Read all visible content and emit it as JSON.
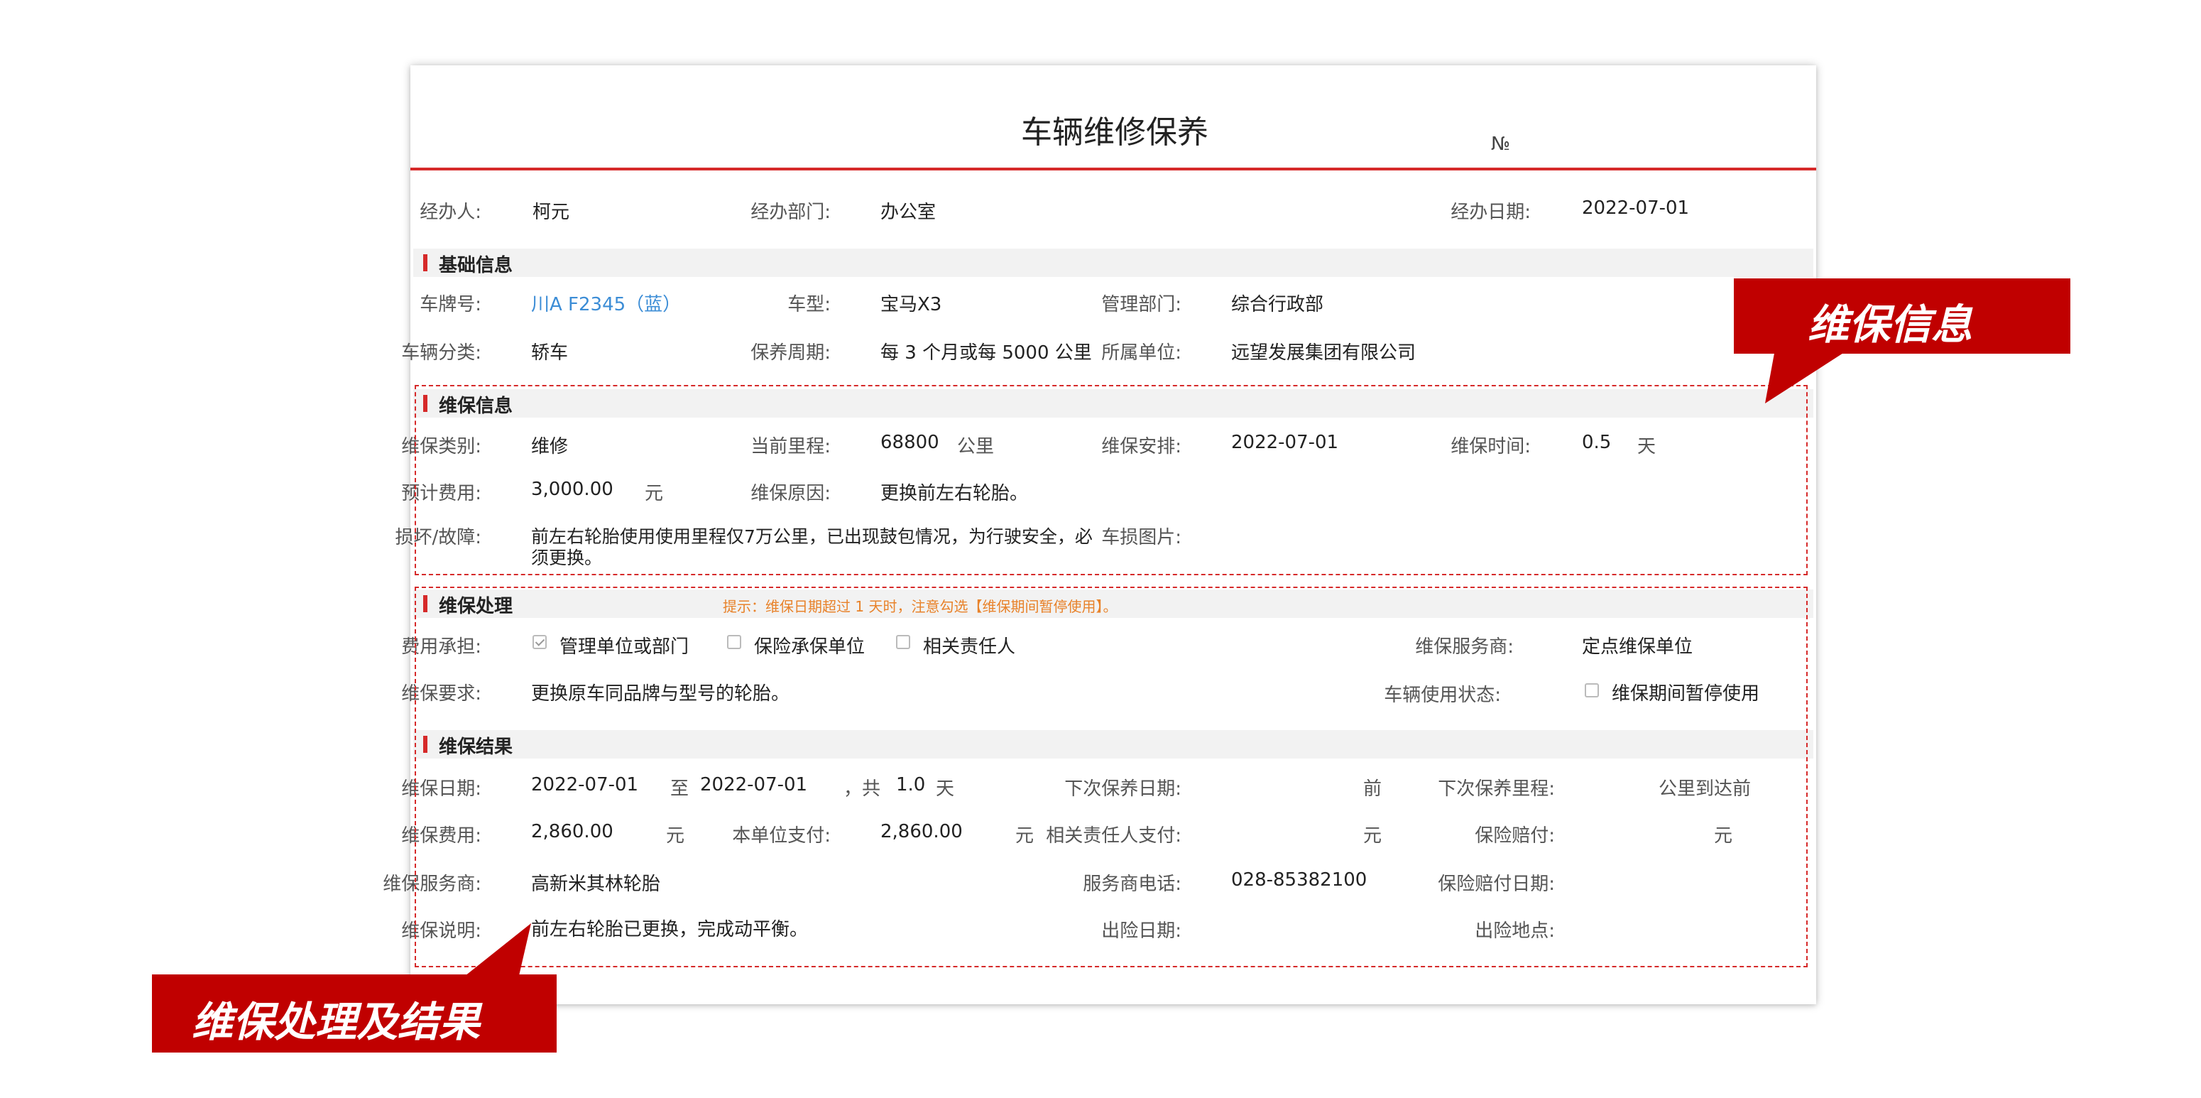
{
  "form": {
    "title": "车辆维修保养",
    "no_label": "№",
    "header": {
      "handler_label": "经办人:",
      "handler": "柯元",
      "dept_label": "经办部门:",
      "dept": "办公室",
      "date_label": "经办日期:",
      "date": "2022-07-01"
    },
    "basic": {
      "title": "基础信息",
      "plate_label": "车牌号:",
      "plate": "川A F2345（蓝）",
      "model_label": "车型:",
      "model": "宝马X3",
      "mgmt_label": "管理部门:",
      "mgmt": "综合行政部",
      "category_label": "车辆分类:",
      "category": "轿车",
      "cycle_label": "保养周期:",
      "cycle": "每 3 个月或每 5000 公里",
      "unit_label": "所属单位:",
      "unit": "远望发展集团有限公司"
    },
    "maint_info": {
      "title": "维保信息",
      "type_label": "维保类别:",
      "type": "维修",
      "mileage_label": "当前里程:",
      "mileage": "68800",
      "mileage_unit": "公里",
      "schedule_label": "维保安排:",
      "schedule": "2022-07-01",
      "duration_label": "维保时间:",
      "duration": "0.5",
      "duration_unit": "天",
      "est_cost_label": "预计费用:",
      "est_cost": "3,000.00",
      "est_cost_unit": "元",
      "reason_label": "维保原因:",
      "reason": "更换前左右轮胎。",
      "damage_label": "损坏/故障:",
      "damage_line1": "前左右轮胎使用使用里程仅7万公里，已出现鼓包情况，为行驶安全，必",
      "damage_line2": "须更换。",
      "photo_label": "车损图片:"
    },
    "processing": {
      "title": "维保处理",
      "hint": "提示：维保日期超过 1 天时，注意勾选【维保期间暂停使用】。",
      "cost_bearer_label": "费用承担:",
      "options": [
        {
          "label": "管理单位或部门",
          "checked": true
        },
        {
          "label": "保险承保单位",
          "checked": false
        },
        {
          "label": "相关责任人",
          "checked": false
        }
      ],
      "provider_label": "维保服务商:",
      "provider": "定点维保单位",
      "requirement_label": "维保要求:",
      "requirement": "更换原车同品牌与型号的轮胎。",
      "status_label": "车辆使用状态:",
      "status_option": "维保期间暂停使用",
      "status_checked": false
    },
    "result": {
      "title": "维保结果",
      "date_label": "维保日期:",
      "date_from": "2022-07-01",
      "to_label": "至",
      "date_to": "2022-07-01",
      "total_label": "，共",
      "days": "1.0",
      "days_unit": "天",
      "next_date_label": "下次保养日期:",
      "next_date_suffix": "前",
      "next_mileage_label": "下次保养里程:",
      "next_mileage_suffix": "公里到达前",
      "cost_label": "维保费用:",
      "cost": "2,860.00",
      "cost_unit": "元",
      "self_pay_label": "本单位支付:",
      "self_pay": "2,860.00",
      "self_pay_unit": "元",
      "person_pay_label": "相关责任人支付:",
      "person_pay_unit": "元",
      "insurance_label": "保险赔付:",
      "insurance_unit": "元",
      "provider_label": "维保服务商:",
      "provider": "高新米其林轮胎",
      "phone_label": "服务商电话:",
      "phone": "028-85382100",
      "ins_date_label": "保险赔付日期:",
      "note_label": "维保说明:",
      "note": "前左右轮胎已更换，完成动平衡。",
      "accident_date_label": "出险日期:",
      "accident_place_label": "出险地点:"
    }
  },
  "callouts": {
    "maint_info": "维保信息",
    "processing_result": "维保处理及结果"
  },
  "colors": {
    "accent": "#d62a2a",
    "callout": "#c00000",
    "link": "#3c8dd6",
    "hint": "#e8822a"
  }
}
